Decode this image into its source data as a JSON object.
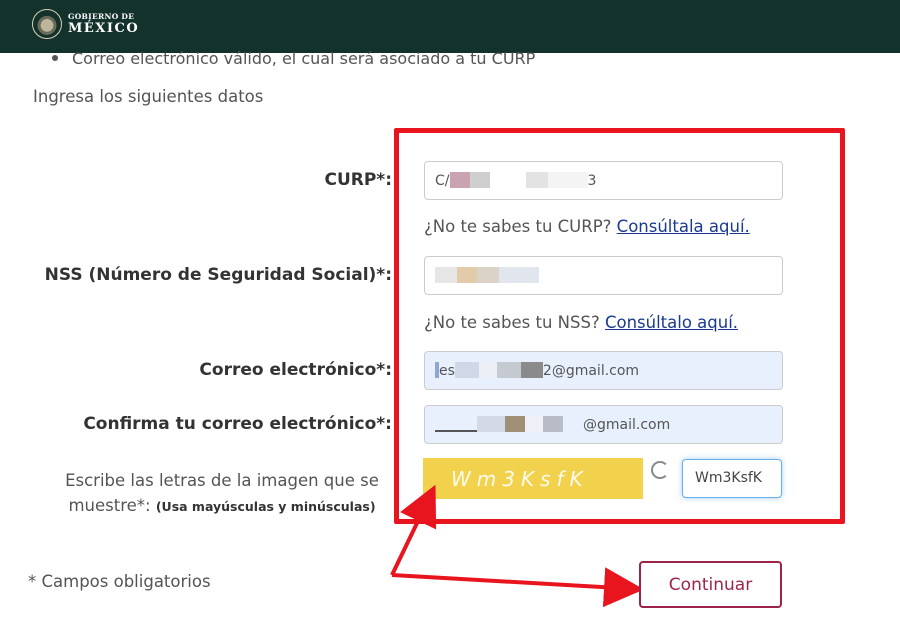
{
  "header": {
    "line1": "GOBIERNO DE",
    "line2": "MÉXICO"
  },
  "requirement_item": "Correo electrónico válido, el cual será asociado a tu CURP",
  "intro": "Ingresa los siguientes datos",
  "form": {
    "curp": {
      "label": "CURP*:",
      "value_prefix": "C/",
      "value_suffix": "3",
      "help_text": "¿No te sabes tu CURP? ",
      "help_link": "Consúltala aquí."
    },
    "nss": {
      "label": "NSS (Número de Seguridad Social)*:",
      "help_text": "¿No te sabes tu NSS? ",
      "help_link": "Consúltalo aquí."
    },
    "email": {
      "label": "Correo electrónico*:",
      "value_prefix": "es",
      "value_suffix": "2@gmail.com"
    },
    "email_confirm": {
      "label": "Confirma tu correo electrónico*:",
      "value_suffix": "@gmail.com"
    },
    "captcha": {
      "label_line1": "Escribe las letras de la imagen que se",
      "label_line2": "muestre*: ",
      "label_note": "(Usa mayúsculas y minúsculas)",
      "image_text": "Wm3KsfK",
      "input_value": "Wm3KsfK"
    }
  },
  "required_note": "* Campos obligatorios",
  "continue_label": "Continuar",
  "colors": {
    "header": "#13322b",
    "accent": "#9d2449",
    "highlight": "#e8141e",
    "link": "#1a3a8f"
  }
}
